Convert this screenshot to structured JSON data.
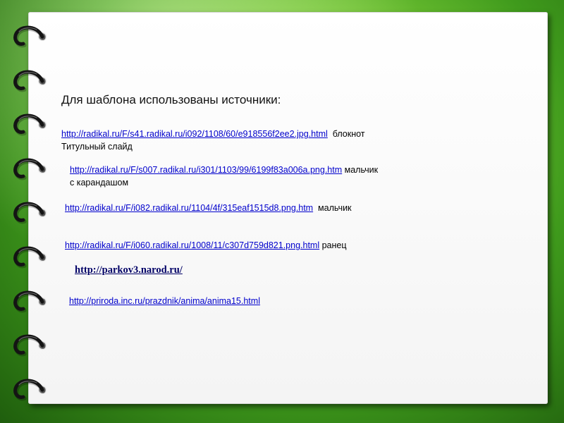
{
  "title": "Для шаблона использованы источники:",
  "sources": [
    {
      "url": "http://radikal.ru/F/s41.radikal.ru/i092/1108/60/e918556f2ee2.jpg.html",
      "note": "блокнот",
      "note2": "Титульный слайд"
    },
    {
      "url": "http://radikal.ru/F/s007.radikal.ru/i301/1103/99/6199f83a006a.png.htm",
      "note": "мальчик",
      "note2": "с карандашом"
    },
    {
      "url": "http://radikal.ru/F/i082.radikal.ru/1104/4f/315eaf1515d8.png.htm",
      "note": "мальчик"
    },
    {
      "url": "http://radikal.ru/F/i060.radikal.ru/1008/11/c307d759d821.png.html",
      "note": "ранец"
    },
    {
      "url": "http://parkov3.narod.ru/"
    },
    {
      "url": "http://priroda.inc.ru/prazdnik/anima/anima15.html"
    }
  ],
  "colors": {
    "link": "#0000cc",
    "background": "#4fa82a",
    "sheet": "#ffffff"
  },
  "icons": {
    "binding": "notebook-ring-icon"
  }
}
